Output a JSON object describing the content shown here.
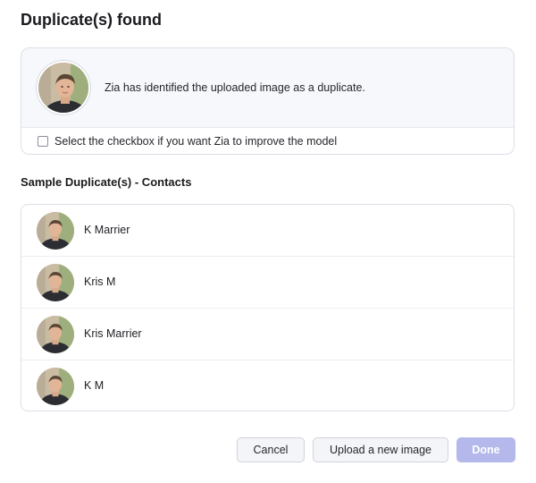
{
  "dialog": {
    "title": "Duplicate(s) found"
  },
  "info": {
    "message": "Zia has identified the uploaded image as a duplicate.",
    "checkbox_label": "Select the checkbox if you want Zia to improve the model",
    "checkbox_checked": false
  },
  "section": {
    "title": "Sample Duplicate(s) - Contacts"
  },
  "contacts": [
    {
      "name": "K Marrier"
    },
    {
      "name": "Kris M"
    },
    {
      "name": "Kris Marrier"
    },
    {
      "name": "K M"
    }
  ],
  "buttons": {
    "cancel": "Cancel",
    "upload": "Upload a new image",
    "done": "Done"
  },
  "colors": {
    "done_button": "#b4b8ea",
    "info_background": "#f6f8fc",
    "border": "#dcdfe7"
  }
}
